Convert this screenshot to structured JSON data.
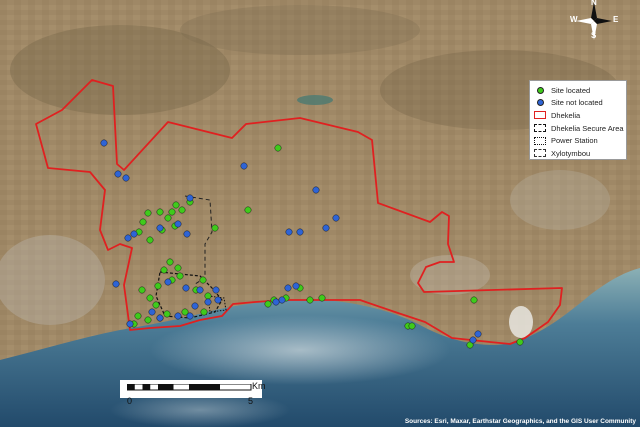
{
  "legend": {
    "items": [
      {
        "label": "Site located",
        "symbol": "green-dot",
        "color": "#3fcb1b"
      },
      {
        "label": "Site not located",
        "symbol": "blue-dot",
        "color": "#2e64d6"
      },
      {
        "label": "Dhekelia",
        "symbol": "red-outline",
        "color": "#e02020"
      },
      {
        "label": "Dhekelia Secure Area",
        "symbol": "dashed-outline",
        "color": "#111111"
      },
      {
        "label": "Power Station",
        "symbol": "dashdot-outline",
        "color": "#111111"
      },
      {
        "label": "Xylotymbou",
        "symbol": "longdash-outline",
        "color": "#333333"
      }
    ]
  },
  "scale": {
    "unit": "Km",
    "start": "0",
    "end": "5"
  },
  "compass": {
    "n": "N",
    "s": "S",
    "e": "E",
    "w": "W"
  },
  "attribution": "Sources: Esri, Maxar, Earthstar Geographics, and the GIS User Community",
  "colors": {
    "land_base": "#a08a68",
    "land_dark": "#7a6a4c",
    "sea_deep": "#2f5a78",
    "sea_shallow": "#7fa6b0",
    "boundary": "#e02020",
    "site_located": "#3fcb1b",
    "site_not_located": "#2e64d6"
  }
}
